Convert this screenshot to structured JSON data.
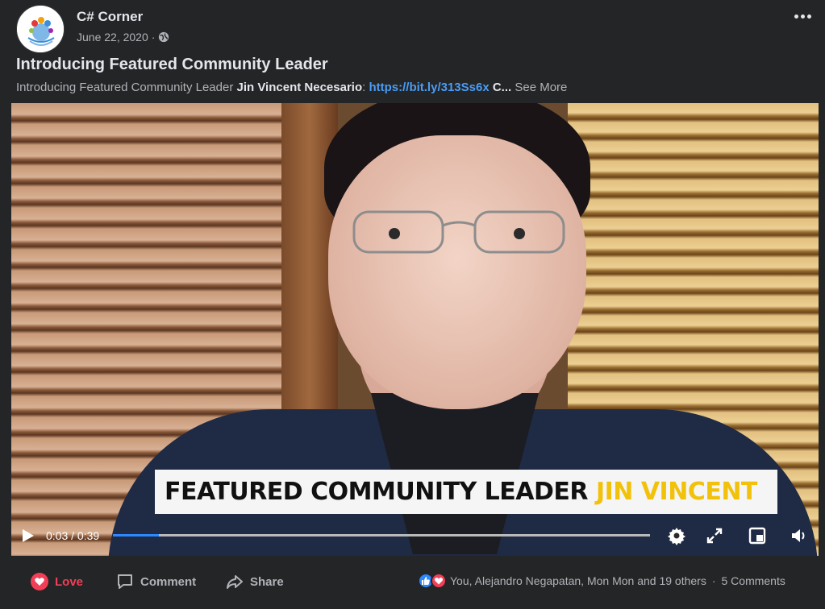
{
  "colors": {
    "background": "#242526",
    "text": "#e4e6eb",
    "muted": "#b0b3b8",
    "link": "#4a9cf6",
    "love": "#f33e58",
    "like": "#2d88ff",
    "highlight": "#f2c10a"
  },
  "post": {
    "page_name": "C# Corner",
    "date": "June 22, 2020",
    "date_separator": "·",
    "privacy_icon": "globe-icon",
    "more_icon": "more-options-icon",
    "title": "Introducing Featured Community Leader",
    "description": {
      "prefix": "Introducing Featured Community Leader ",
      "name": "Jin Vincent Necesario",
      "colon": ": ",
      "link": "https://bit.ly/313Ss6x",
      "trail": " C...",
      "see_more": " See More"
    }
  },
  "video": {
    "banner_text": "FEATURED COMMUNITY LEADER",
    "banner_highlight": "JIN VINCENT",
    "current_time": "0:03",
    "time_separator": " / ",
    "duration": "0:39",
    "progress_fraction": 0.085,
    "icons": [
      "play-icon",
      "settings-icon",
      "fullscreen-icon",
      "picture-in-picture-icon",
      "volume-icon"
    ]
  },
  "actions": {
    "love_label": "Love",
    "comment_label": "Comment",
    "share_label": "Share",
    "reactions_text": "You, Alejandro Negapatan, Mon Mon and 19 others",
    "separator": "·",
    "comments_count": "5 Comments"
  }
}
